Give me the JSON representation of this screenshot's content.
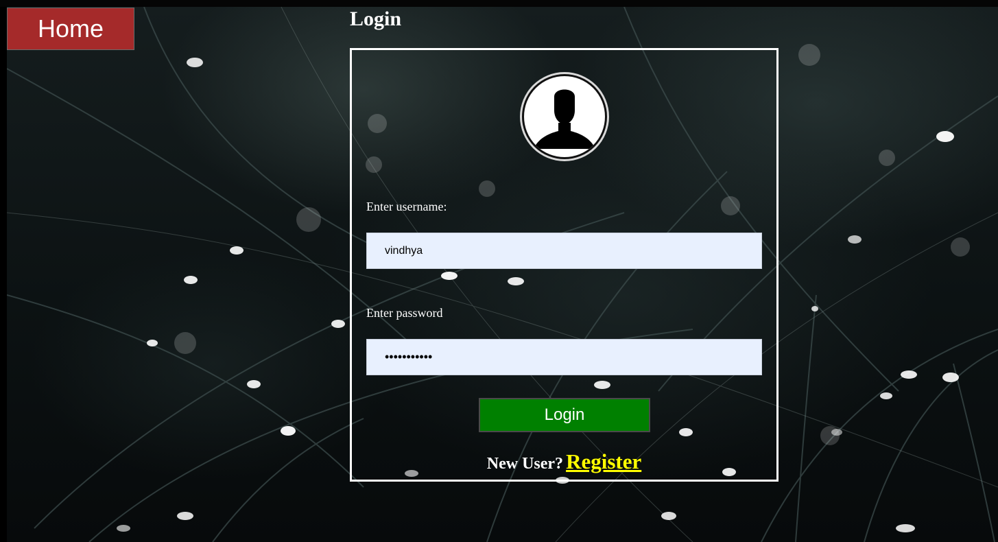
{
  "nav": {
    "home_label": "Home"
  },
  "page": {
    "title": "Login"
  },
  "form": {
    "avatar_icon": "user-silhouette-icon",
    "username_label": "Enter username:",
    "username_value": "vindhya",
    "password_label": "Enter password",
    "password_value": "vindhya1234",
    "login_label": "Login",
    "new_user_text": "New User?",
    "register_label": "Register"
  },
  "colors": {
    "home_button": "#a52a2a",
    "login_button": "#008000",
    "register_link": "#ffff00",
    "input_background": "#e8f0fe",
    "box_border": "#ffffff"
  }
}
